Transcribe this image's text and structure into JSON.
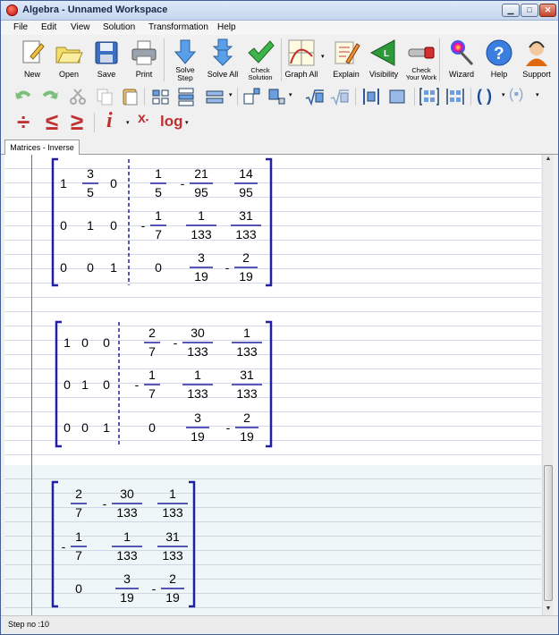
{
  "window": {
    "title": "Algebra - Unnamed Workspace"
  },
  "menu": [
    "File",
    "Edit",
    "View",
    "Solution",
    "Transformation",
    "Help"
  ],
  "toolbar": [
    {
      "id": "new",
      "label": "New",
      "icon": "new-doc-icon"
    },
    {
      "id": "open",
      "label": "Open",
      "icon": "open-folder-icon"
    },
    {
      "id": "save",
      "label": "Save",
      "icon": "floppy-icon"
    },
    {
      "id": "print",
      "label": "Print",
      "icon": "printer-icon"
    },
    {
      "id": "solve-step",
      "label": "Solve Step",
      "icon": "down-arrow-icon"
    },
    {
      "id": "solve-all",
      "label": "Solve All",
      "icon": "double-down-arrow-icon"
    },
    {
      "id": "check-solution",
      "label": "Check Solution",
      "icon": "checkmark-icon"
    },
    {
      "id": "graph-all",
      "label": "Graph All",
      "icon": "graph-icon"
    },
    {
      "id": "explain",
      "label": "Explain",
      "icon": "explain-pencil-icon"
    },
    {
      "id": "visibility",
      "label": "Visibility",
      "icon": "visibility-icon"
    },
    {
      "id": "check-work",
      "label": "Check Your Work",
      "icon": "check-work-icon"
    },
    {
      "id": "wizard",
      "label": "Wizard",
      "icon": "wizard-wand-icon"
    },
    {
      "id": "help",
      "label": "Help",
      "icon": "help-icon"
    },
    {
      "id": "support",
      "label": "Support",
      "icon": "support-headset-icon"
    }
  ],
  "format_toolbar": {
    "log_label": "log",
    "italic_label": "i"
  },
  "tab": {
    "label": "Matrices - Inverse"
  },
  "matrices": [
    {
      "left": [
        [
          "1",
          "3/5",
          "0"
        ],
        [
          "0",
          "1",
          "0"
        ],
        [
          "0",
          "0",
          "1"
        ]
      ],
      "right": [
        [
          "1/5",
          "-21/95",
          "14/95"
        ],
        [
          "-1/7",
          "1/133",
          "31/133"
        ],
        [
          "0",
          "3/19",
          "-2/19"
        ]
      ]
    },
    {
      "left": [
        [
          "1",
          "0",
          "0"
        ],
        [
          "0",
          "1",
          "0"
        ],
        [
          "0",
          "0",
          "1"
        ]
      ],
      "right": [
        [
          "2/7",
          "-30/133",
          "1/133"
        ],
        [
          "-1/7",
          "1/133",
          "31/133"
        ],
        [
          "0",
          "3/19",
          "-2/19"
        ]
      ]
    },
    {
      "left": [],
      "right": [
        [
          "2/7",
          "-30/133",
          "1/133"
        ],
        [
          "-1/7",
          "1/133",
          "31/133"
        ],
        [
          "0",
          "3/19",
          "-2/19"
        ]
      ]
    }
  ],
  "status": {
    "text": "Step no :10"
  },
  "colors": {
    "bracket": "#2020a0",
    "fraction_bar": "#2020a0",
    "margin_line": "#c0504d",
    "highlight": "#eef6f8"
  }
}
